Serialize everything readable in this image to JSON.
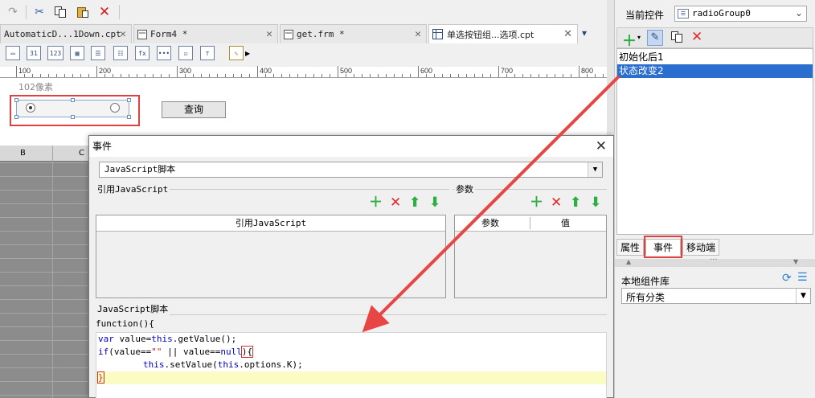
{
  "tabs": [
    {
      "label": "AutomaticD...1Down.cpt"
    },
    {
      "label": "Form4 *"
    },
    {
      "label": "get.frm *"
    },
    {
      "label": "单选按钮组...选项.cpt"
    }
  ],
  "toolbar2": {
    "date_label": "31",
    "num_label": "123",
    "fx_label": "fx"
  },
  "ruler": {
    "labels": [
      "100",
      "200",
      "300",
      "400",
      "500",
      "600",
      "700",
      "800"
    ]
  },
  "canvas": {
    "size_hint": "102像素",
    "query_button": "查询"
  },
  "grid": {
    "col_b": "B",
    "col_c": "C"
  },
  "dialog": {
    "title": "事件",
    "script_type": "JavaScript脚本",
    "ref_js_group": "引用JavaScript",
    "params_group": "参数",
    "ref_js_header": "引用JavaScript",
    "params_col_param": "参数",
    "params_col_value": "值",
    "js_script_group": "JavaScript脚本",
    "function_header": "function(){",
    "code": {
      "line1_kw": "var",
      "line1_rest": " value=",
      "line1_this": "this",
      "line1_end": ".getValue();",
      "line2_if": "if",
      "line2_a": "(value==",
      "line2_str": "\"\"",
      "line2_b": " || value==",
      "line2_null": "null",
      "line2_c": "){",
      "line3_this1": "this",
      "line3_mid": ".setValue(",
      "line3_this2": "this",
      "line3_end": ".options.K);",
      "line4": "}"
    }
  },
  "right": {
    "current_widget_label": "当前控件",
    "current_widget_value": "radioGroup0",
    "events": [
      {
        "label": "初始化后1"
      },
      {
        "label": "状态改变2"
      }
    ],
    "tabs": {
      "props": "属性",
      "events": "事件",
      "mobile": "移动端"
    },
    "local_lib_label": "本地组件库",
    "category_value": "所有分类"
  }
}
